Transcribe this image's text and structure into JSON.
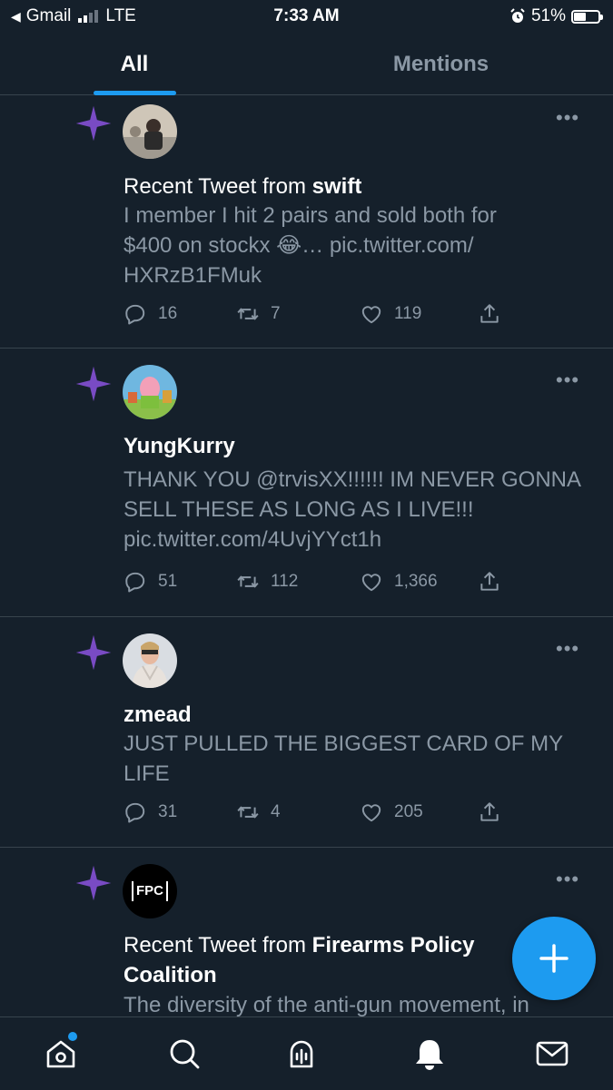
{
  "status_bar": {
    "back_app": "Gmail",
    "network": "LTE",
    "time": "7:33 AM",
    "battery": "51%",
    "battery_level": 0.51
  },
  "tabs": [
    {
      "label": "All",
      "active": true
    },
    {
      "label": "Mentions",
      "active": false
    }
  ],
  "notifications": [
    {
      "prefix": "Recent Tweet from ",
      "user": "swift",
      "text": "I member I hit 2 pairs and sold both for $400 on stockx 😂… pic.twitter.com/ HXRzB1FMuk",
      "replies": "16",
      "retweets": "7",
      "likes": "119"
    },
    {
      "prefix": "",
      "user": "YungKurry",
      "text": "THANK YOU @trvisXX!!!!!! IM NEVER GONNA SELL THESE AS LONG AS I LIVE!!! pic.twitter.com/4UvjYYct1h",
      "replies": "51",
      "retweets": "112",
      "likes": "1,366"
    },
    {
      "prefix": "",
      "user": "zmead",
      "text": "JUST PULLED THE BIGGEST CARD OF MY LIFE",
      "replies": "31",
      "retweets": "4",
      "likes": "205"
    },
    {
      "prefix": "Recent Tweet from ",
      "user": "Firearms Policy Coalition",
      "text": "The diversity of the anti-gun movement, in",
      "avatar_text": "FPC"
    }
  ],
  "colors": {
    "background": "#15202b",
    "accent": "#1d9bf0",
    "sparkle": "#794bc4",
    "muted": "#8b98a5",
    "divider": "#38444d"
  }
}
